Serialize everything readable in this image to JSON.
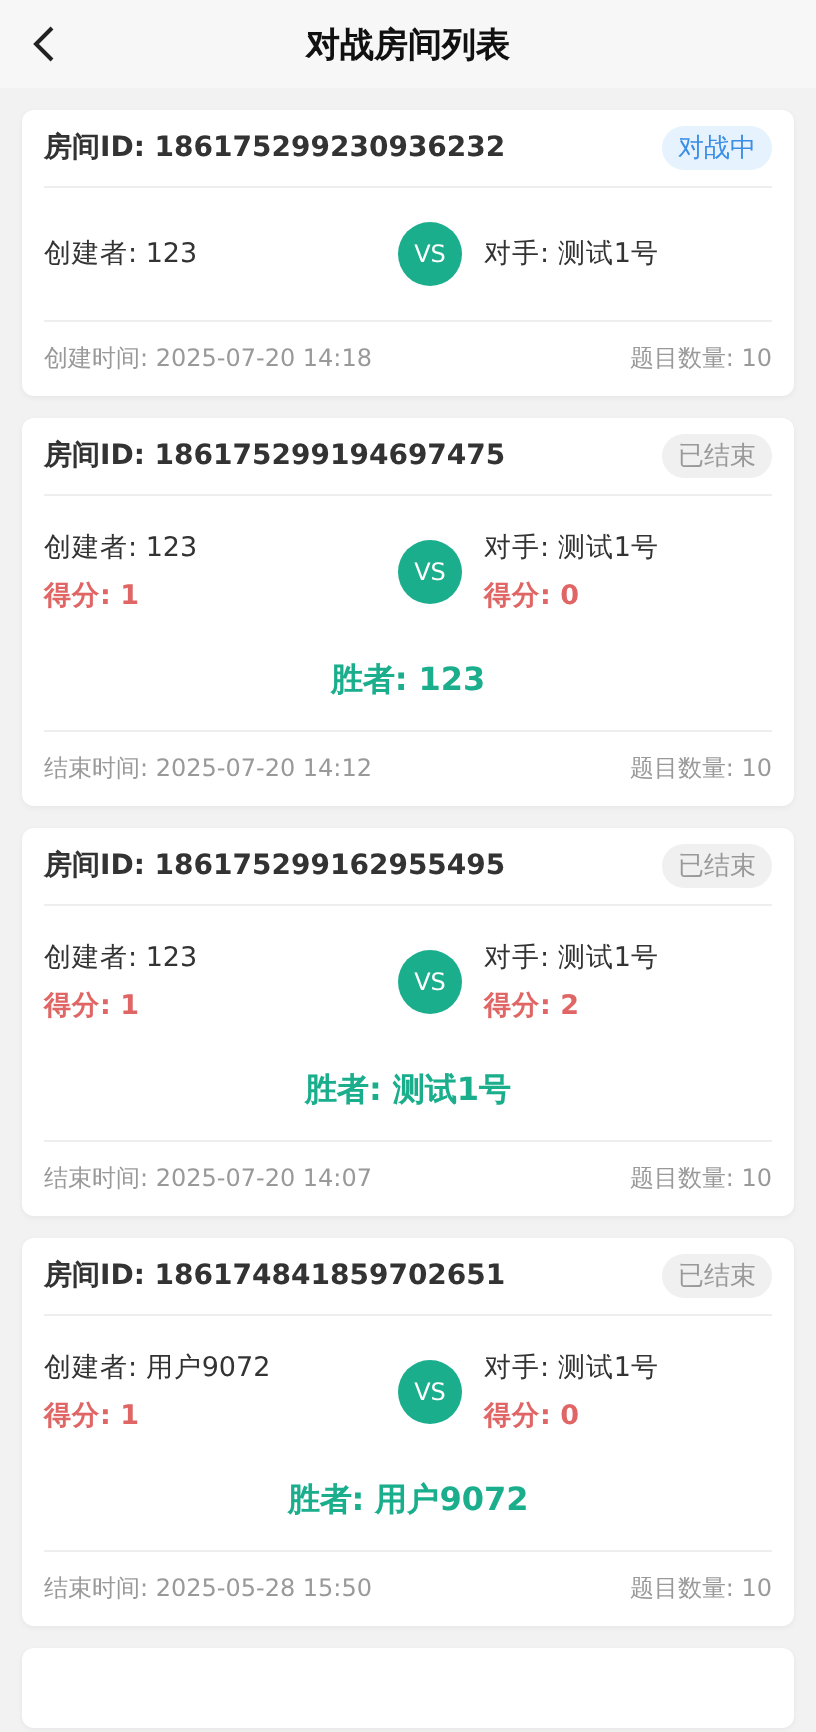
{
  "header": {
    "title": "对战房间列表"
  },
  "rooms": [
    {
      "id": "房间ID: 186175299230936232",
      "status": {
        "label": "对战中",
        "kind": "ongoing"
      },
      "creator": "创建者: 123",
      "opponent": "对手: 测试1号",
      "time": "创建时间: 2025-07-20 14:18",
      "count": "题目数量: 10"
    },
    {
      "id": "房间ID: 186175299194697475",
      "status": {
        "label": "已结束",
        "kind": "finished"
      },
      "creator": "创建者: 123",
      "creator_score": "得分: 1",
      "opponent": "对手: 测试1号",
      "opponent_score": "得分: 0",
      "vs": "VS",
      "winner": "胜者: 123",
      "time": "结束时间: 2025-07-20 14:12",
      "count": "题目数量: 10"
    },
    {
      "id": "房间ID: 186175299162955495",
      "status": {
        "label": "已结束",
        "kind": "finished"
      },
      "creator": "创建者: 123",
      "creator_score": "得分: 1",
      "opponent": "对手: 测试1号",
      "opponent_score": "得分: 2",
      "vs": "VS",
      "winner": "胜者: 测试1号",
      "time": "结束时间: 2025-07-20 14:07",
      "count": "题目数量: 10"
    },
    {
      "id": "房间ID: 186174841859702651",
      "status": {
        "label": "已结束",
        "kind": "finished"
      },
      "creator": "创建者: 用户9072",
      "creator_score": "得分: 1",
      "opponent": "对手: 测试1号",
      "opponent_score": "得分: 0",
      "vs": "VS",
      "winner": "胜者: 用户9072",
      "time": "结束时间: 2025-05-28 15:50",
      "count": "题目数量: 10"
    }
  ],
  "vs": "VS",
  "more_below": true
}
